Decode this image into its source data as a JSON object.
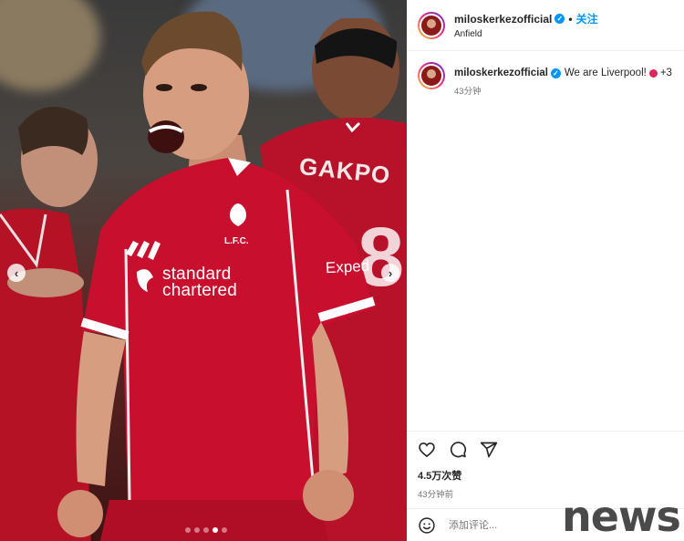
{
  "header": {
    "username": "miloskerkezofficial",
    "separator": "•",
    "follow_label": "关注",
    "location": "Anfield"
  },
  "caption": {
    "username": "miloskerkezofficial",
    "text": "We are Liverpool!",
    "extra": "+3",
    "time": "43分钟"
  },
  "photo": {
    "shirt_name": "GAKPO",
    "sponsor_line1": "standard",
    "sponsor_line2": "chartered",
    "crest_text": "L.F.C.",
    "sleeve_sponsor": "Exped",
    "shirt_number": "8",
    "carousel_dots": 5,
    "active_dot": 3
  },
  "actions": {
    "likes": "4.5万次赞",
    "post_time": "43分钟前"
  },
  "comment": {
    "placeholder": "添加评论..."
  },
  "watermark": "news",
  "colors": {
    "accent": "#0095f6",
    "text": "#262626",
    "muted": "#737373",
    "shirt_red": "#c8102e"
  }
}
